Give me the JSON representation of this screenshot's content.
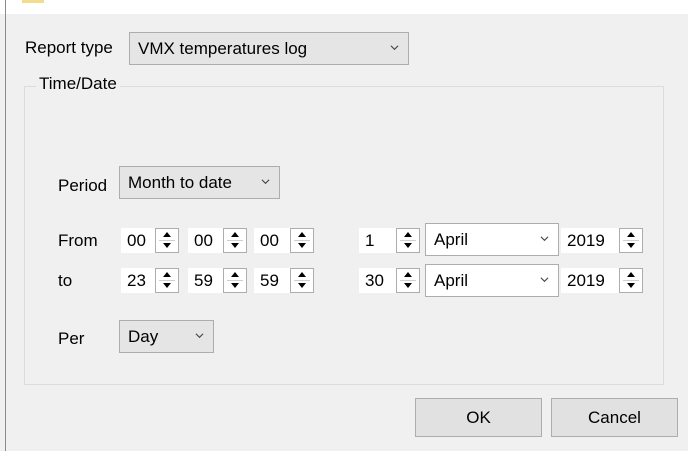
{
  "report_type": {
    "label": "Report type",
    "value": "VMX temperatures log"
  },
  "time_date": {
    "title": "Time/Date",
    "period": {
      "label": "Period",
      "value": "Month to date"
    },
    "from": {
      "label": "From",
      "hh": "00",
      "mm": "00",
      "ss": "00",
      "day": "1",
      "month": "April",
      "year": "2019"
    },
    "to": {
      "label": "to",
      "hh": "23",
      "mm": "59",
      "ss": "59",
      "day": "30",
      "month": "April",
      "year": "2019"
    },
    "per": {
      "label": "Per",
      "value": "Day"
    }
  },
  "buttons": {
    "ok": "OK",
    "cancel": "Cancel"
  },
  "icons": {
    "dropdown": "chevron-down-icon",
    "spin_up": "spin-up-icon",
    "spin_down": "spin-down-icon"
  }
}
